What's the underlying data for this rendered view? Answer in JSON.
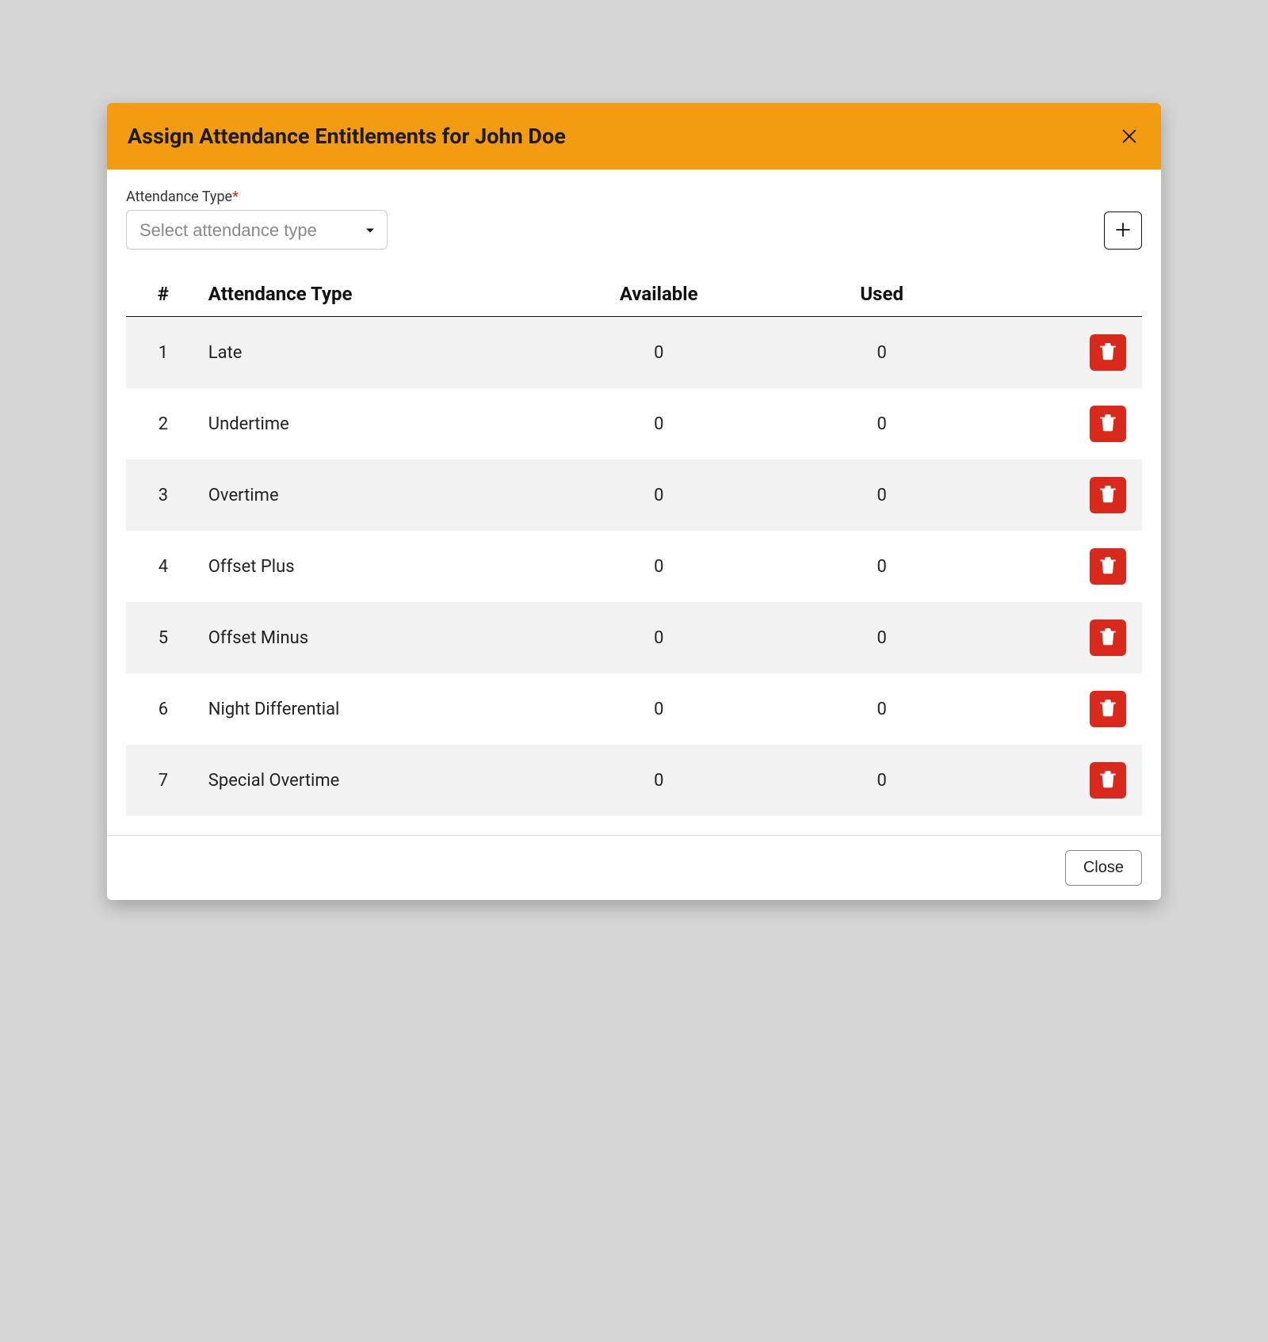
{
  "header": {
    "title": "Assign Attendance Entitlements for John Doe"
  },
  "form": {
    "attendance_type_label": "Attendance Type",
    "required_mark": "*",
    "select_placeholder": "Select attendance type"
  },
  "table": {
    "headers": {
      "num": "#",
      "type": "Attendance Type",
      "available": "Available",
      "used": "Used"
    },
    "rows": [
      {
        "num": "1",
        "type": "Late",
        "available": "0",
        "used": "0"
      },
      {
        "num": "2",
        "type": "Undertime",
        "available": "0",
        "used": "0"
      },
      {
        "num": "3",
        "type": "Overtime",
        "available": "0",
        "used": "0"
      },
      {
        "num": "4",
        "type": "Offset Plus",
        "available": "0",
        "used": "0"
      },
      {
        "num": "5",
        "type": "Offset Minus",
        "available": "0",
        "used": "0"
      },
      {
        "num": "6",
        "type": "Night Differential",
        "available": "0",
        "used": "0"
      },
      {
        "num": "7",
        "type": "Special Overtime",
        "available": "0",
        "used": "0"
      }
    ]
  },
  "footer": {
    "close_label": "Close"
  },
  "colors": {
    "accent": "#f39c12",
    "danger": "#d9281c"
  }
}
